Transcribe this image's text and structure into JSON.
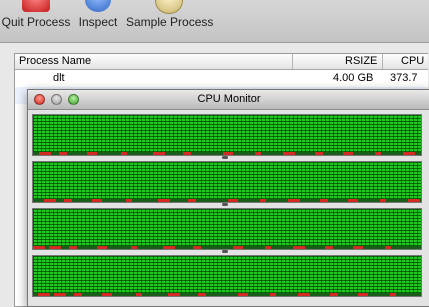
{
  "toolbar": {
    "quit_label": "Quit Process",
    "inspect_label": "Inspect",
    "sample_label": "Sample Process",
    "quit_icon": "stop-sign-icon",
    "inspect_icon": "info-icon",
    "sample_icon": "magnifier-icon"
  },
  "process_list": {
    "columns": {
      "name": "Process Name",
      "rsize": "RSIZE",
      "cpu": "CPU"
    },
    "rows": [
      {
        "name": "dlt",
        "rsize": "4.00 GB",
        "cpu": "373.7"
      }
    ]
  },
  "cpu_monitor": {
    "title": "CPU Monitor",
    "cores": [
      {
        "level": 1.0
      },
      {
        "level": 1.0
      },
      {
        "level": 1.0
      },
      {
        "level": 1.0
      }
    ],
    "colors": {
      "user": "#1ecb1e",
      "system": "#d42a22",
      "grid": "#004600"
    }
  }
}
